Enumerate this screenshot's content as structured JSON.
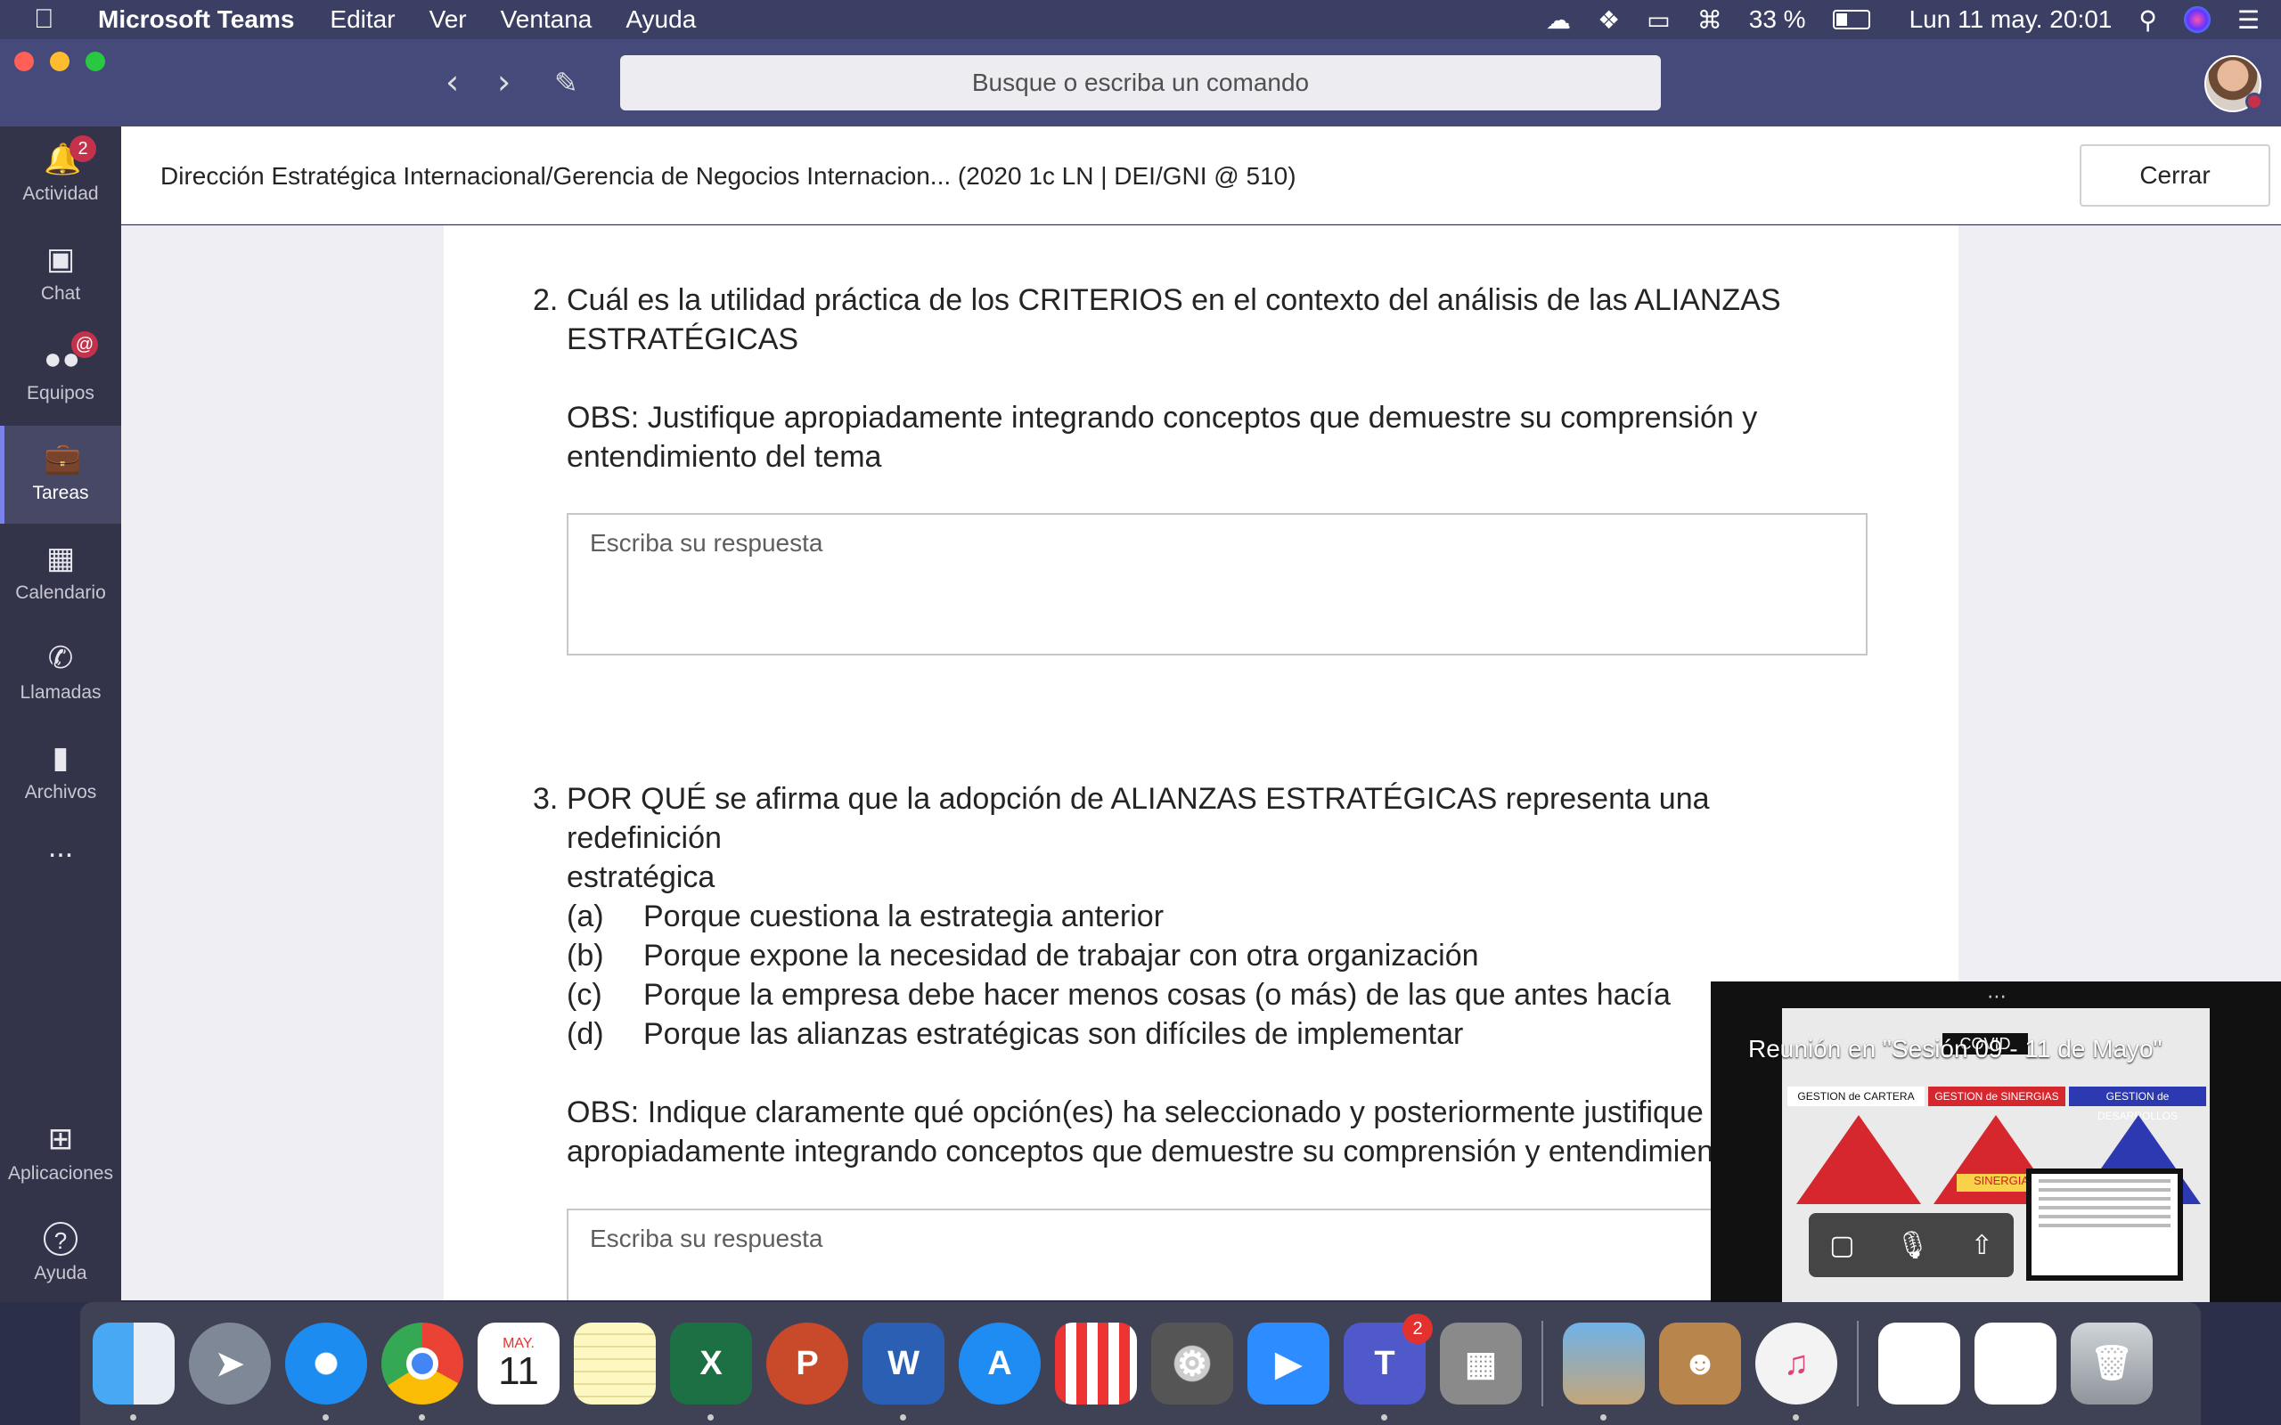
{
  "menubar": {
    "app_name": "Microsoft Teams",
    "menus": [
      "Editar",
      "Ver",
      "Ventana",
      "Ayuda"
    ],
    "battery": "33 %",
    "datetime": "Lun 11 may.  20:01"
  },
  "titlebar": {
    "search_placeholder": "Busque o escriba un comando"
  },
  "rail": {
    "items": [
      {
        "label": "Actividad",
        "icon": "bell-icon",
        "badge": "2"
      },
      {
        "label": "Chat",
        "icon": "chat-icon"
      },
      {
        "label": "Equipos",
        "icon": "teams-icon",
        "badge": "@"
      },
      {
        "label": "Tareas",
        "icon": "assignments-icon"
      },
      {
        "label": "Calendario",
        "icon": "calendar-icon"
      },
      {
        "label": "Llamadas",
        "icon": "phone-icon"
      },
      {
        "label": "Archivos",
        "icon": "file-icon"
      },
      {
        "label": "...",
        "icon": "more-icon"
      },
      {
        "label": "Aplicaciones",
        "icon": "apps-icon"
      },
      {
        "label": "Ayuda",
        "icon": "help-icon"
      }
    ]
  },
  "header": {
    "title": "Dirección Estratégica Internacional/Gerencia de Negocios Internacion... (2020 1c LN | DEI/GNI @ 510)",
    "close_label": "Cerrar"
  },
  "questions": {
    "q2": {
      "number": "2.",
      "line1": "Cuál es la utilidad práctica de los CRITERIOS en el contexto del análisis de las ALIANZAS",
      "line2": "ESTRATÉGICAS",
      "obs1": "OBS: Justifique apropiadamente integrando conceptos que demuestre su comprensión y",
      "obs2": "entendimiento del tema",
      "answer_placeholder": "Escriba su respuesta"
    },
    "q3": {
      "number": "3.",
      "line1": "POR QUÉ se afirma que la adopción de ALIANZAS ESTRATÉGICAS representa una redefinición",
      "line2": "estratégica",
      "options": [
        {
          "letter": "(a)",
          "text": "Porque cuestiona la estrategia anterior"
        },
        {
          "letter": "(b)",
          "text": "Porque expone la necesidad de trabajar con otra organización"
        },
        {
          "letter": "(c)",
          "text": "Porque la empresa debe hacer menos cosas (o más) de las que antes hacía"
        },
        {
          "letter": "(d)",
          "text": "Porque las alianzas estratégicas son difíciles de implementar"
        }
      ],
      "obs1": "OBS: Indique claramente qué opción(es) ha seleccionado y posteriormente justifique",
      "obs2": "apropiadamente integrando conceptos que demuestre su comprensión y entendimien",
      "answer_placeholder": "Escriba su respuesta"
    }
  },
  "meeting": {
    "title": "Reunión en \"Sesión 09 - 11 de Mayo\"",
    "slide_columns": [
      "GESTION de CARTERA",
      "GESTION de SINERGIAS",
      "GESTION de DESARROLLOS"
    ],
    "slide_badge": "COVID",
    "slide_label": "SINERGIA"
  },
  "dock": {
    "calendar_month": "MAY.",
    "calendar_day": "11",
    "teams_badge": "2"
  }
}
